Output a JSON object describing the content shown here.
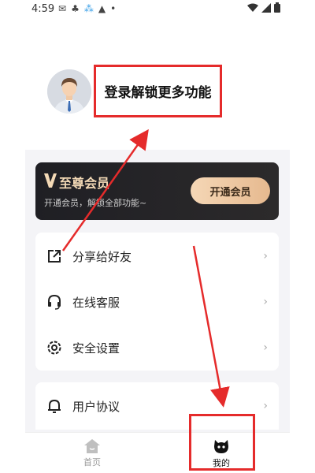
{
  "status_bar": {
    "time": "4:59",
    "left_icons": [
      "mail-icon",
      "app-icon",
      "app-icon",
      "warning-icon",
      "dot-icon"
    ],
    "right_icons": [
      "wifi-icon",
      "signal-icon",
      "battery-icon"
    ]
  },
  "profile": {
    "login_text": "登录解锁更多功能"
  },
  "vip": {
    "title": "至尊会员",
    "subtitle": "开通会员，解锁全部功能~",
    "button_label": "开通会员",
    "brand_color": "#f3d9b6"
  },
  "menu": {
    "items": [
      {
        "label": "分享给好友",
        "icon": "share-icon"
      },
      {
        "label": "在线客服",
        "icon": "headset-icon"
      },
      {
        "label": "安全设置",
        "icon": "settings-icon"
      },
      {
        "label": "用户协议",
        "icon": "bell-icon"
      }
    ]
  },
  "tab_bar": {
    "tabs": [
      {
        "label": "首页",
        "icon": "home-icon",
        "active": false
      },
      {
        "label": "我的",
        "icon": "mine-icon",
        "active": true
      }
    ]
  },
  "annotations": {
    "highlight_color": "#e52b2b"
  }
}
